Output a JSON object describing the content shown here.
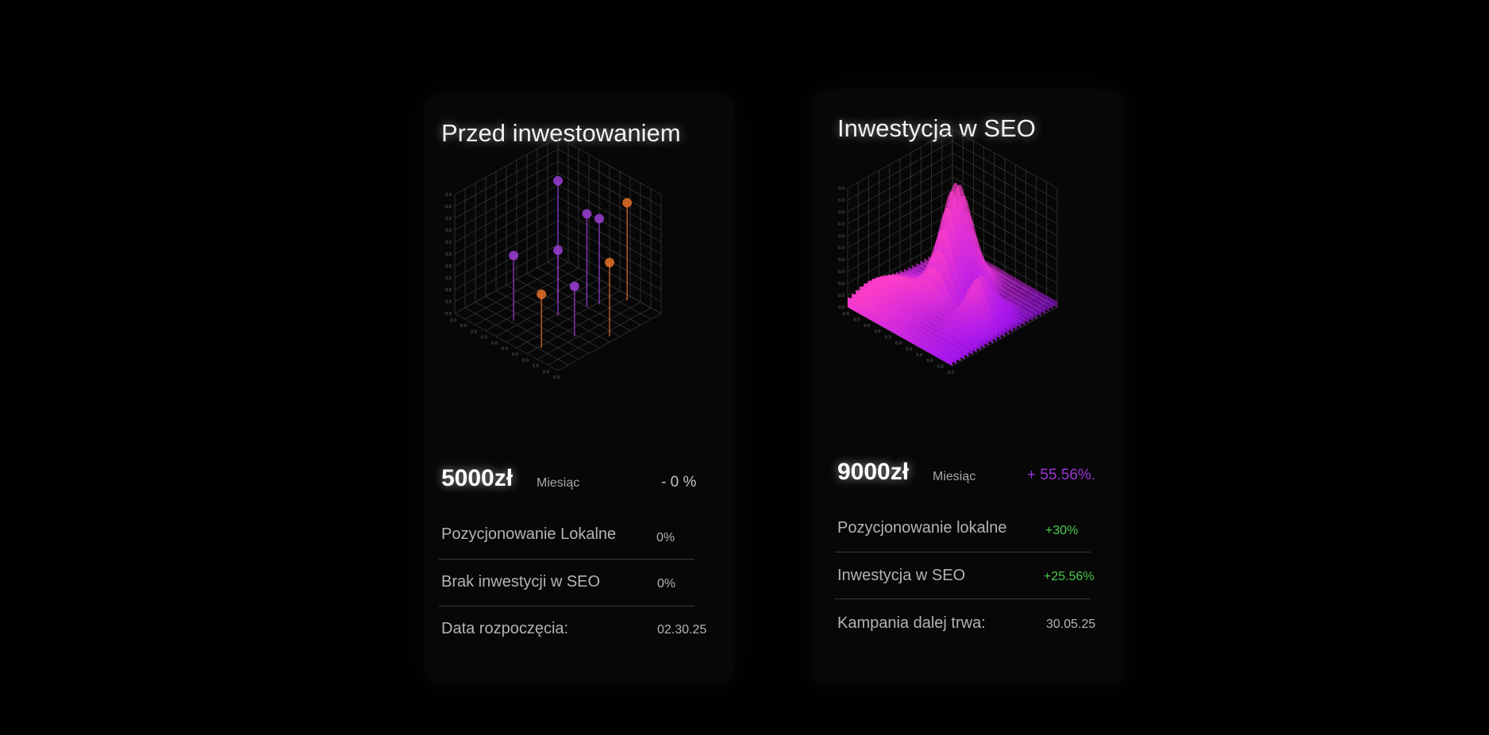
{
  "cards": [
    {
      "title": "Przed inwestowaniem",
      "price": "5000zł",
      "period": "Miesiąc",
      "change": "- 0 %",
      "change_color": "#c4c4c4",
      "rows": [
        {
          "label": "Pozycjonowanie Lokalne",
          "value": "0%",
          "value_color": "#b3b3b3"
        },
        {
          "label": "Brak inwestycji w SEO",
          "value": "0%",
          "value_color": "#b3b3b3"
        },
        {
          "label": "Data rozpoczęcia:",
          "value": "02.30.25",
          "value_color": "#b3b3b3"
        }
      ],
      "chart": {
        "type": "3d-stem-scatter",
        "colors": {
          "purple": "#9b3fd6",
          "orange": "#e8702a"
        }
      }
    },
    {
      "title": "Inwestycja w SEO",
      "price": "9000zł",
      "period": "Miesiąc",
      "change": "+ 55.56%.",
      "change_color": "#9a34d4",
      "rows": [
        {
          "label": "Pozycjonowanie lokalne",
          "value": "+30%",
          "value_color": "#4cc94c"
        },
        {
          "label": "Inwestycja w SEO",
          "value": "+25.56%",
          "value_color": "#4cc94c"
        },
        {
          "label": "Kampania dalej trwa:",
          "value": "30.05.25",
          "value_color": "#b3b3b3"
        }
      ],
      "chart": {
        "type": "3d-surface",
        "colors": {
          "low": "#9d12f5",
          "high": "#ff3ec8"
        }
      }
    }
  ]
}
